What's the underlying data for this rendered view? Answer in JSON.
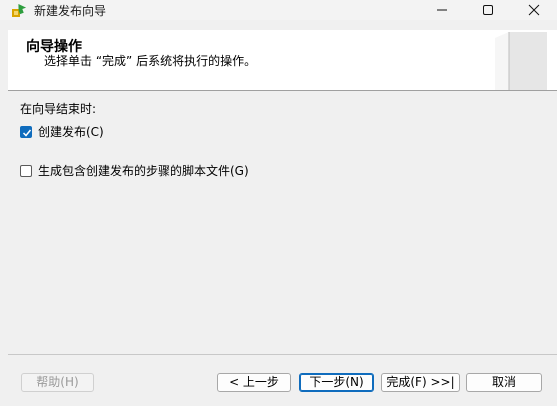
{
  "window": {
    "title": "新建发布向导",
    "icon": "wizard-app-icon",
    "controls": [
      "minimize-icon",
      "maximize-icon",
      "close-icon"
    ]
  },
  "header": {
    "title": "向导操作",
    "subtitle": "选择单击 “完成” 后系统将执行的操作。",
    "art": "book-graphic"
  },
  "body": {
    "section_label": "在向导结束时:",
    "options": [
      {
        "label": "创建发布(C)",
        "checked": true
      },
      {
        "label": "生成包含创建发布的步骤的脚本文件(G)",
        "checked": false
      }
    ]
  },
  "footer": {
    "help": "帮助(H)",
    "back": "< 上一步",
    "next": "下一步(N)",
    "finish": "完成(F) >>|",
    "cancel": "取消"
  },
  "colors": {
    "accent": "#0f6cbd",
    "banner_bg": "#ffffff",
    "dialog_bg": "#f0f0f0"
  }
}
